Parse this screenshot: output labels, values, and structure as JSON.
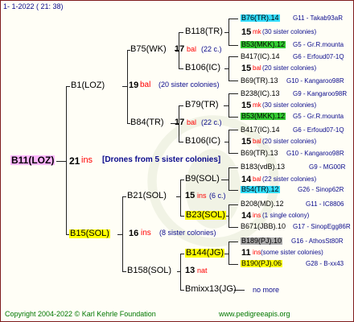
{
  "header": {
    "date": "1-  1-2022 ( 21: 38)"
  },
  "tree": {
    "root": {
      "name": "B11(LOZ)",
      "year": "21",
      "breeder": "ins",
      "note": "[Drones from 5 sister colonies]"
    },
    "g1": [
      {
        "name": "B1(LOZ)",
        "year": "19",
        "breeder": "bal",
        "note": "(20 sister colonies)"
      },
      {
        "name": "B15(SOL)",
        "year": "16",
        "breeder": "ins",
        "note": "(8 sister colonies)"
      }
    ],
    "g2": [
      {
        "name": "B75(WK)",
        "year": "17",
        "breeder": "bal",
        "note": "(22 c.)"
      },
      {
        "name": "B84(TR)",
        "year": "17",
        "breeder": "bal",
        "note": "(22 c.)"
      },
      {
        "name": "B21(SOL)",
        "year": "15",
        "breeder": "ins",
        "note": "(6 c.)"
      },
      {
        "name": "B158(SOL)",
        "year": "13",
        "breeder": "nat",
        "note": ""
      }
    ],
    "g3": [
      {
        "name": "B118(TR)",
        "year": "15",
        "breeder": "mk",
        "note": "(30 sister colonies)"
      },
      {
        "name": "B106(IC)",
        "year": "15",
        "breeder": "bal",
        "note": "(20 sister colonies)"
      },
      {
        "name": "B79(TR)",
        "year": "15",
        "breeder": "mk",
        "note": "(30 sister colonies)"
      },
      {
        "name": "B106(IC)",
        "year": "15",
        "breeder": "bal",
        "note": "(20 sister colonies)"
      },
      {
        "name": "B9(SOL)",
        "year": "14",
        "breeder": "bal",
        "note": "(22 sister colonies)"
      },
      {
        "name": "B23(SOL)",
        "year": "14",
        "breeder": "ins",
        "note": "(1 single colony)"
      },
      {
        "name": "B144(JG)",
        "year": "11",
        "breeder": "ins",
        "note": "(some sister colonies)"
      },
      {
        "name": "Bmixx13(JG)",
        "year": "",
        "breeder": "",
        "note": "no more"
      }
    ],
    "g4": [
      {
        "name": "B76(TR).14",
        "loc": "G11 - Takab93aR"
      },
      {
        "name": "B53(MKK).12",
        "loc": "G5 - Gr.R.mounta"
      },
      {
        "name": "B417(IC).14",
        "loc": "G6 - Erfoud07-1Q"
      },
      {
        "name": "B69(TR).13",
        "loc": "G10 - Kangaroo98R"
      },
      {
        "name": "B238(IC).13",
        "loc": "G9 - Kangaroo98R"
      },
      {
        "name": "B53(MKK).12",
        "loc": "G5 - Gr.R.mounta"
      },
      {
        "name": "B417(IC).14",
        "loc": "G6 - Erfoud07-1Q"
      },
      {
        "name": "B69(TR).13",
        "loc": "G10 - Kangaroo98R"
      },
      {
        "name": "B183(vdB).13",
        "loc": "G9 - MG00R"
      },
      {
        "name": "B54(TR).12",
        "loc": "G26 - Sinop62R"
      },
      {
        "name": "B208(MD).12",
        "loc": "G11 - IC8806"
      },
      {
        "name": "B671(JBB).10",
        "loc": "G17 - SinopEgg86R"
      },
      {
        "name": "B189(PJ).10",
        "loc": "G16 - AthosSt80R"
      },
      {
        "name": "B190(PJ).06",
        "loc": "G28 - B-xx43"
      }
    ]
  },
  "footer": {
    "copyright": "Copyright 2004-2022 © Karl Kehrle Foundation",
    "site": "www.pedigreeapis.org"
  }
}
